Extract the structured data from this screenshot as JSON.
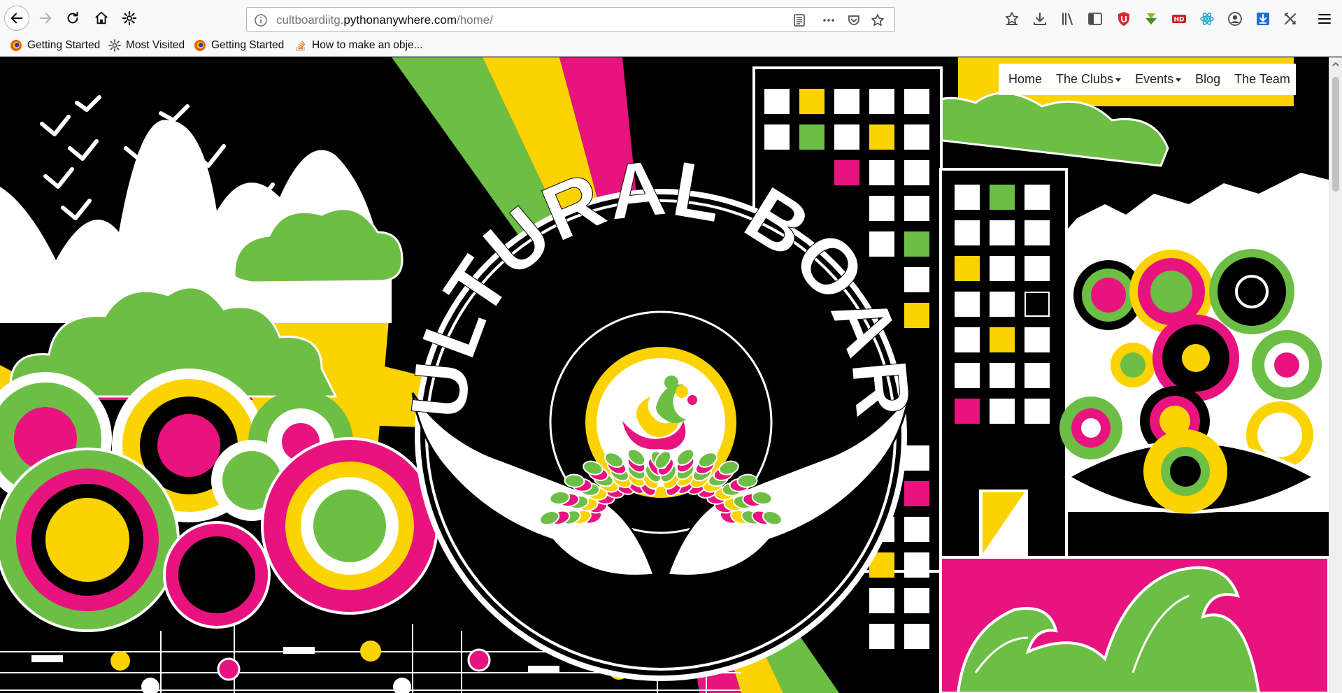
{
  "browser": {
    "url_prefix": "cultboardiitg.",
    "url_domain": "pythonanywhere.com",
    "url_path": "/home/",
    "bookmarks": [
      {
        "label": "Getting Started",
        "icon": "firefox-icon"
      },
      {
        "label": "Most Visited",
        "icon": "gear-icon"
      },
      {
        "label": "Getting Started",
        "icon": "firefox-icon"
      },
      {
        "label": "How to make an obje...",
        "icon": "stackoverflow-icon"
      }
    ]
  },
  "site": {
    "banner_text": "CULTURAL BOARD",
    "nav": [
      {
        "label": "Home",
        "dropdown": false
      },
      {
        "label": "The Clubs",
        "dropdown": true
      },
      {
        "label": "Events",
        "dropdown": true
      },
      {
        "label": "Blog",
        "dropdown": false
      },
      {
        "label": "The Team",
        "dropdown": false
      }
    ]
  },
  "colors": {
    "pink": "#e8137e",
    "yellow": "#fbd300",
    "green": "#6dbe45",
    "black": "#000000",
    "white": "#ffffff"
  }
}
